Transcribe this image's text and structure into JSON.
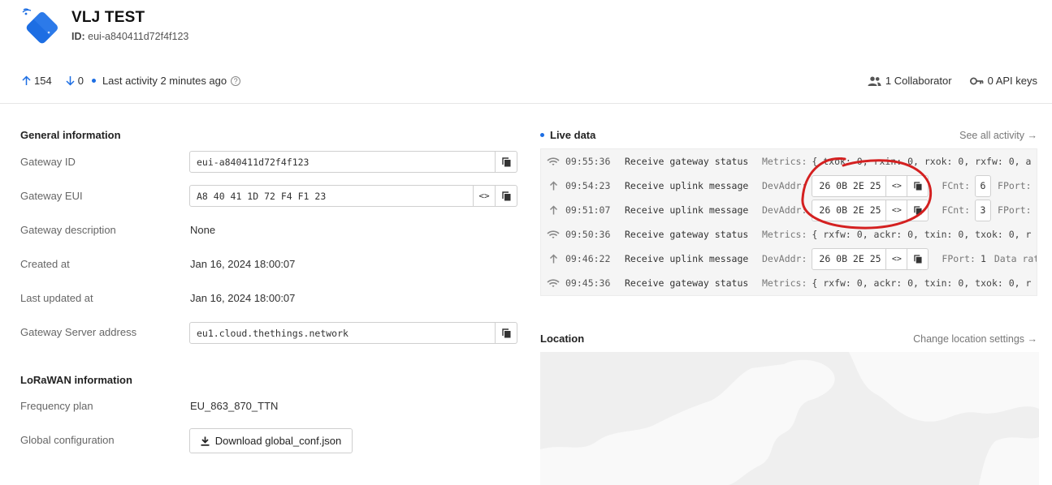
{
  "header": {
    "title": "VLJ TEST",
    "id_label": "ID:",
    "id_value": "eui-a840411d72f4f123",
    "uplink_count": "154",
    "downlink_count": "0",
    "last_activity": "Last activity 2 minutes ago",
    "help": "?",
    "collaborators": "1 Collaborator",
    "api_keys": "0 API keys"
  },
  "general": {
    "title": "General information",
    "rows": [
      {
        "label": "Gateway ID",
        "value": "eui-a840411d72f4f123"
      },
      {
        "label": "Gateway EUI",
        "value": "A8 40 41 1D 72 F4 F1 23"
      },
      {
        "label": "Gateway description",
        "value": "None"
      },
      {
        "label": "Created at",
        "value": "Jan 16, 2024 18:00:07"
      },
      {
        "label": "Last updated at",
        "value": "Jan 16, 2024 18:00:07"
      },
      {
        "label": "Gateway Server address",
        "value": "eu1.cloud.thethings.network"
      }
    ],
    "eui_toggle": "<>"
  },
  "lorawan": {
    "title": "LoRaWAN information",
    "frequency_label": "Frequency plan",
    "frequency_value": "EU_863_870_TTN",
    "global_conf_label": "Global configuration",
    "download_label": "Download global_conf.json"
  },
  "live": {
    "title": "Live data",
    "see_all": "See all activity →",
    "events": [
      {
        "type": "status",
        "time": "09:55:36",
        "msg": "Receive gateway status",
        "label": "Metrics:",
        "text": "{ txok: 0, rxin: 0, rxok: 0, rxfw: 0, a"
      },
      {
        "type": "uplink",
        "time": "09:54:23",
        "msg": "Receive uplink message",
        "label": "DevAddr:",
        "devaddr": "26 0B 2E 25",
        "toggle": "<>",
        "fcnt_label": "FCnt:",
        "fcnt": "6",
        "fport_label": "FPort:"
      },
      {
        "type": "uplink",
        "time": "09:51:07",
        "msg": "Receive uplink message",
        "label": "DevAddr:",
        "devaddr": "26 0B 2E 25",
        "toggle": "<>",
        "fcnt_label": "FCnt:",
        "fcnt": "3",
        "fport_label": "FPort:"
      },
      {
        "type": "status",
        "time": "09:50:36",
        "msg": "Receive gateway status",
        "label": "Metrics:",
        "text": "{ rxfw: 0, ackr: 0, txin: 0, txok: 0, r"
      },
      {
        "type": "uplink2",
        "time": "09:46:22",
        "msg": "Receive uplink message",
        "label": "DevAddr:",
        "devaddr": "26 0B 2E 25",
        "toggle": "<>",
        "fport_label": "FPort:",
        "fport": "1",
        "rate": "Data rat"
      },
      {
        "type": "status",
        "time": "09:45:36",
        "msg": "Receive gateway status",
        "label": "Metrics:",
        "text": "{ rxfw: 0, ackr: 0, txin: 0, txok: 0, r"
      }
    ]
  },
  "location": {
    "title": "Location",
    "link": "Change location settings →"
  },
  "colors": {
    "accent": "#1d6ee3",
    "annotation": "#d42020"
  }
}
